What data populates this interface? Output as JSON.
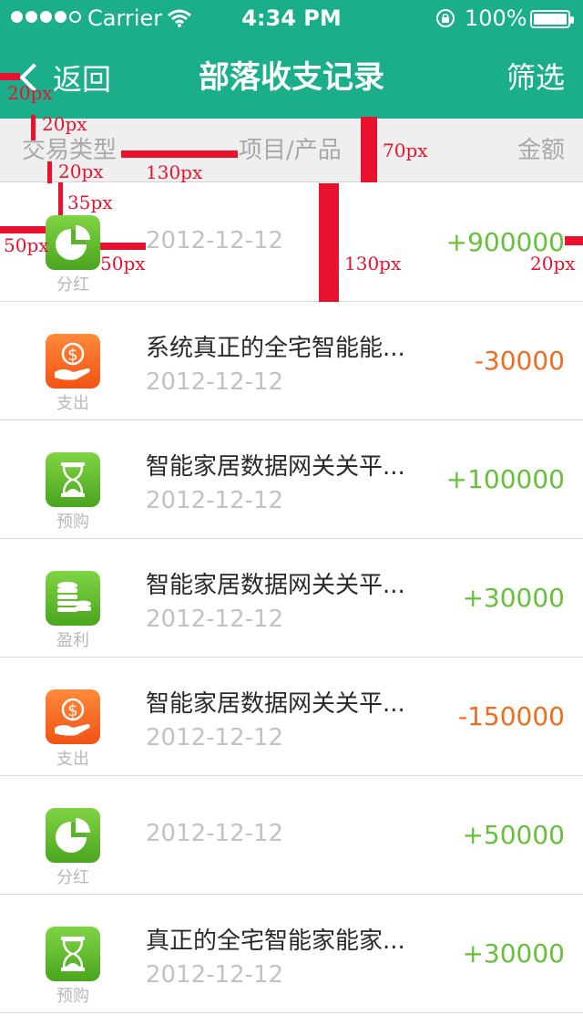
{
  "status_bar": {
    "carrier": "Carrier",
    "time": "4:34 PM",
    "battery": "100%"
  },
  "nav": {
    "back_label": "返回",
    "title": "部落收支记录",
    "filter_label": "筛选"
  },
  "columns": {
    "type": "交易类型",
    "item": "项目/产品",
    "amount": "金额"
  },
  "rows": [
    {
      "type_label": "分红",
      "icon": "pie-chart-icon",
      "color": "green",
      "name": "",
      "date": "2012-12-12",
      "amount": "+900000",
      "sign": "pos"
    },
    {
      "type_label": "支出",
      "icon": "dollar-hand-icon",
      "color": "orange",
      "name": "系统真正的全宅智能能...",
      "date": "2012-12-12",
      "amount": "-30000",
      "sign": "neg"
    },
    {
      "type_label": "预购",
      "icon": "hourglass-icon",
      "color": "green",
      "name": "智能家居数据网关关平...",
      "date": "2012-12-12",
      "amount": "+100000",
      "sign": "pos"
    },
    {
      "type_label": "盈利",
      "icon": "coins-icon",
      "color": "green",
      "name": "智能家居数据网关关平...",
      "date": "2012-12-12",
      "amount": "+30000",
      "sign": "pos"
    },
    {
      "type_label": "支出",
      "icon": "dollar-hand-icon",
      "color": "orange",
      "name": "智能家居数据网关关平...",
      "date": "2012-12-12",
      "amount": "-150000",
      "sign": "neg"
    },
    {
      "type_label": "分红",
      "icon": "pie-chart-icon",
      "color": "green",
      "name": "",
      "date": "2012-12-12",
      "amount": "+50000",
      "sign": "pos"
    },
    {
      "type_label": "预购",
      "icon": "hourglass-icon",
      "color": "green",
      "name": "真正的全宅智能家能家...",
      "date": "2012-12-12",
      "amount": "+30000",
      "sign": "pos"
    }
  ],
  "annotations": {
    "a1": "20px",
    "a2": "20px",
    "a3": "20px",
    "a4": "130px",
    "a5": "70px",
    "a6": "35px",
    "a7": "50px",
    "a8": "50px",
    "a9": "130px",
    "a10": "20px"
  },
  "colors": {
    "header": "#1aae8a",
    "positive": "#66c13a",
    "negative": "#f26b1e",
    "annotation": "#e8122e"
  }
}
